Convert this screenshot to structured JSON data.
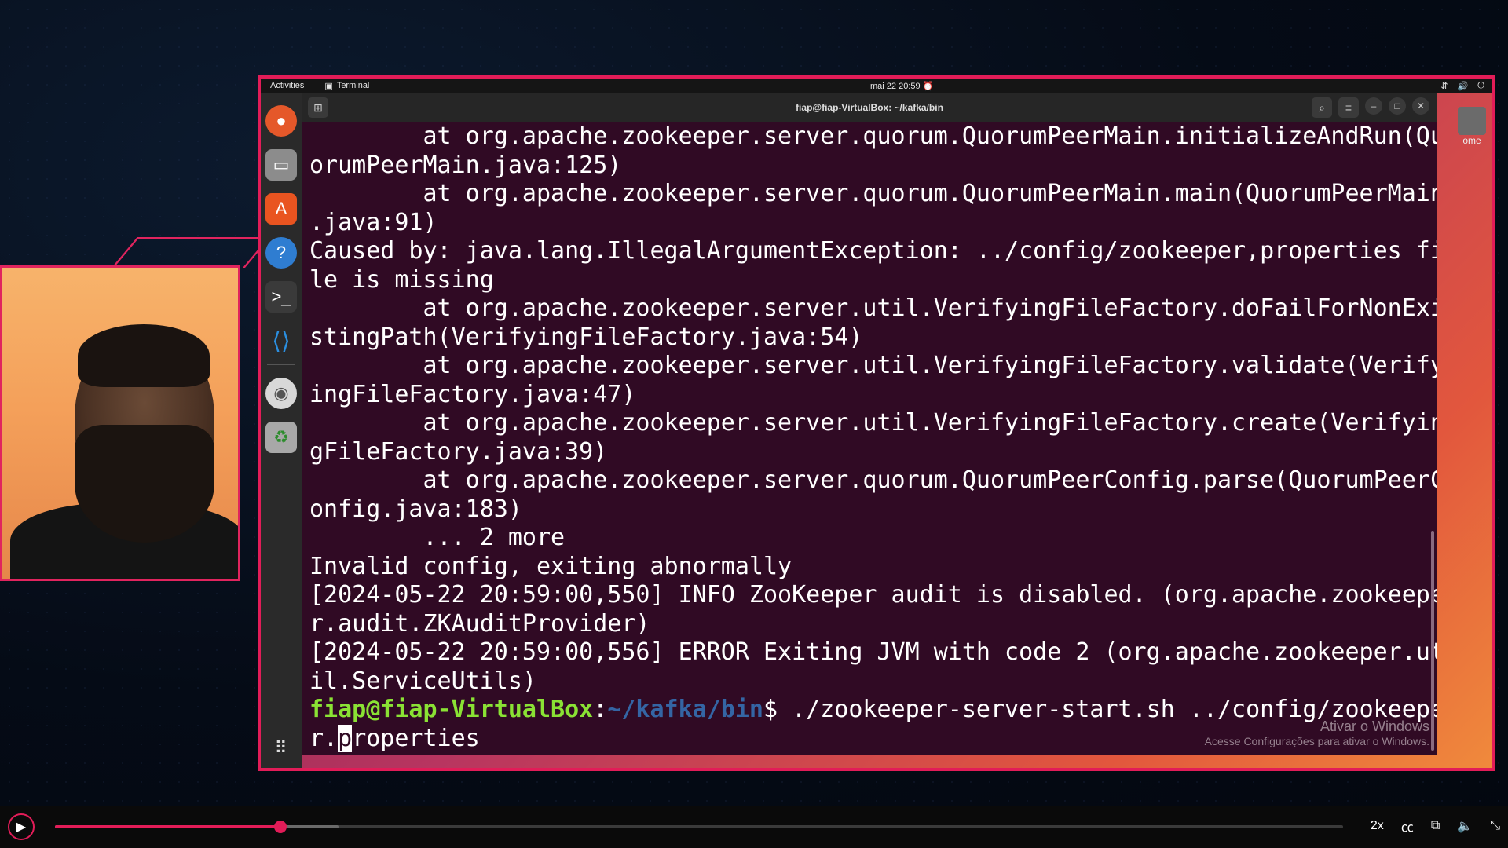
{
  "ubuntu_topbar": {
    "activities": "Activities",
    "app": "Terminal",
    "clock": "mai 22  20:59"
  },
  "terminal": {
    "title": "fiap@fiap-VirtualBox: ~/kafka/bin",
    "lines": [
      "        at org.apache.zookeeper.server.quorum.QuorumPeerMain.initializeAndRun(Qu",
      "orumPeerMain.java:125)",
      "        at org.apache.zookeeper.server.quorum.QuorumPeerMain.main(QuorumPeerMain",
      ".java:91)",
      "Caused by: java.lang.IllegalArgumentException: ../config/zookeeper,properties fi",
      "le is missing",
      "        at org.apache.zookeeper.server.util.VerifyingFileFactory.doFailForNonExi",
      "stingPath(VerifyingFileFactory.java:54)",
      "        at org.apache.zookeeper.server.util.VerifyingFileFactory.validate(Verify",
      "ingFileFactory.java:47)",
      "        at org.apache.zookeeper.server.util.VerifyingFileFactory.create(Verifyin",
      "gFileFactory.java:39)",
      "        at org.apache.zookeeper.server.quorum.QuorumPeerConfig.parse(QuorumPeerC",
      "onfig.java:183)",
      "        ... 2 more",
      "Invalid config, exiting abnormally",
      "[2024-05-22 20:59:00,550] INFO ZooKeeper audit is disabled. (org.apache.zookeepe",
      "r.audit.ZKAuditProvider)",
      "[2024-05-22 20:59:00,556] ERROR Exiting JVM with code 2 (org.apache.zookeeper.ut",
      "il.ServiceUtils)"
    ],
    "prompt_user": "fiap@fiap-VirtualBox",
    "prompt_sep": ":",
    "prompt_path": "~/kafka/bin",
    "prompt_symbol": "$ ",
    "command_line1": "./zookeeper-server-start.sh ../config/zookeepe",
    "command_line2_before": "r.",
    "command_line2_cursor": "p",
    "command_line2_after": "roperties"
  },
  "watermark": {
    "title": "Ativar o Windows",
    "subtitle": "Acesse Configurações para ativar o Windows."
  },
  "desktop_icon": {
    "label": "ome"
  },
  "player": {
    "speed": "2x",
    "progress_fraction": 0.175,
    "buffered_fraction": 0.22
  }
}
